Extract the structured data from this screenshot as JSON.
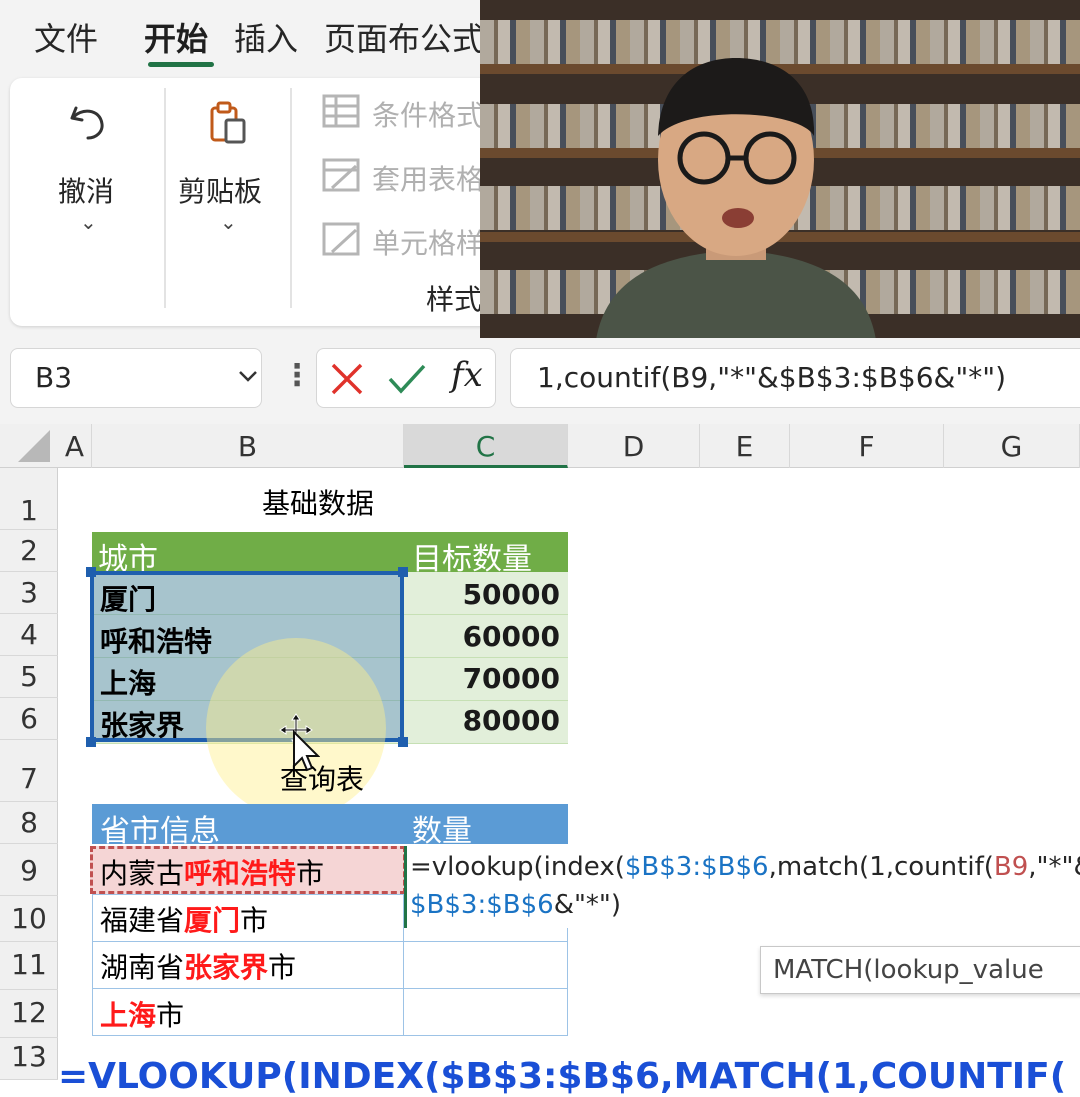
{
  "ribbon_tabs": [
    "文件",
    "开始",
    "插入",
    "页面布",
    "公式"
  ],
  "ribbon": {
    "undo_label": "撤消",
    "clipboard_label": "剪贴板",
    "styles_items": [
      "条件格式",
      "套用表格",
      "单元格样"
    ],
    "styles_group_label": "样式"
  },
  "formula_bar": {
    "name_box": "B3",
    "formula": "1,countif(B9,\"*\"&$B$3:$B$6&\"*\")"
  },
  "columns": [
    "A",
    "B",
    "C",
    "D",
    "E",
    "F",
    "G"
  ],
  "rows": [
    "1",
    "2",
    "3",
    "4",
    "5",
    "6",
    "7",
    "8",
    "9",
    "10",
    "11",
    "12",
    "13"
  ],
  "sheet": {
    "title1": "基础数据",
    "table1_headers": [
      "城市",
      "目标数量"
    ],
    "table1_rows": [
      {
        "city": "厦门",
        "qty": "50000"
      },
      {
        "city": "呼和浩特",
        "qty": "60000"
      },
      {
        "city": "上海",
        "qty": "70000"
      },
      {
        "city": "张家界",
        "qty": "80000"
      }
    ],
    "title2": "查询表",
    "table2_headers": [
      "省市信息",
      "数量"
    ],
    "table2_rows": [
      {
        "prefix": "内蒙古",
        "city": "呼和浩特",
        "suffix": "市"
      },
      {
        "prefix": "福建省",
        "city": "厦门",
        "suffix": "市"
      },
      {
        "prefix": "湖南省",
        "city": "张家界",
        "suffix": "市"
      },
      {
        "prefix": "",
        "city": "上海",
        "suffix": "市"
      }
    ],
    "edit_formula": {
      "line1_a": "=vlookup(index(",
      "line1_b": "$B$3:$B$6",
      "line1_c": ",match(1,countif(",
      "line1_d": "B9",
      "line1_e": ",\"*\"&",
      "line2_a": "$B$3:$B$6",
      "line2_b": "&\"*\")"
    },
    "tooltip": "MATCH(lookup_value",
    "bottom_caption": "=VLOOKUP(INDEX($B$3:$B$6,MATCH(1,COUNTIF("
  },
  "colors": {
    "header_green": "#70ad47",
    "header_blue": "#5b9bd5",
    "excel_green": "#217346",
    "selection_blue": "#1f5fae",
    "red_text": "#ff1a1a"
  }
}
